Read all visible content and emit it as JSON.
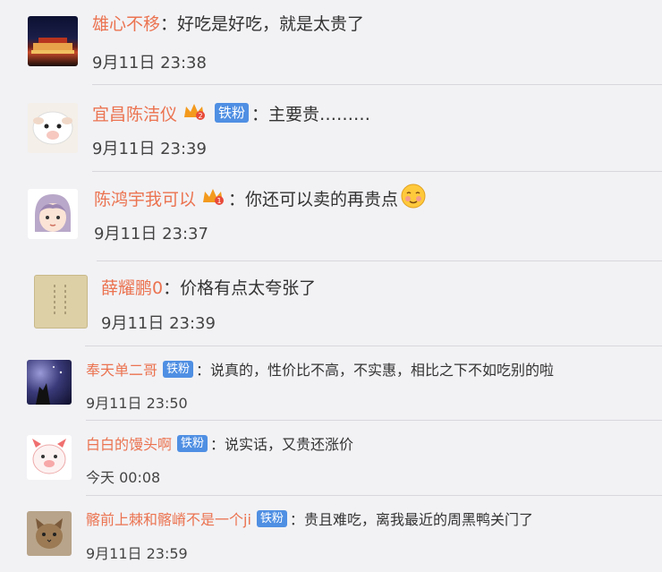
{
  "comments": [
    {
      "name": "雄心不移",
      "sep": "：",
      "text": "好吃是好吃，就是太贵了",
      "time": "9月11日 23:38",
      "avatar": "night-building-avatar"
    },
    {
      "name": "宜昌陈洁仪",
      "badge": "铁粉",
      "sep": "：",
      "text": "主要贵………",
      "time": "9月11日 23:39",
      "avatar": "sheep-avatar"
    },
    {
      "name": "陈鸿宇我可以",
      "sep": "：",
      "text": "你还可以卖的再贵点",
      "time": "9月11日 23:37",
      "avatar": "cartoon-girl-avatar"
    },
    {
      "name": "薛耀鹏0",
      "sep": "：",
      "text": "价格有点太夸张了",
      "time": "9月11日 23:39",
      "avatar": "calligraphy-avatar"
    },
    {
      "name": "奉天单二哥",
      "badge": "铁粉",
      "sep": "：",
      "text": "说真的，性价比不高，不实惠，相比之下不如吃别的啦",
      "time": "9月11日 23:50",
      "avatar": "night-sky-avatar"
    },
    {
      "name": "白白的馒头啊",
      "badge": "铁粉",
      "sep": "：",
      "text": "说实话，又贵还涨价",
      "time": "今天 00:08",
      "avatar": "pig-avatar"
    },
    {
      "name": "髂前上棘和髂嵴不是一个ji",
      "badge": "铁粉",
      "sep": "：",
      "text": "贵且难吃，离我最近的周黑鸭关门了",
      "time": "9月11日 23:59",
      "avatar": "cat-avatar"
    }
  ],
  "colors": {
    "name": "#eb7350",
    "badge": "#4f8fe3",
    "background": "#f2f2f5"
  }
}
